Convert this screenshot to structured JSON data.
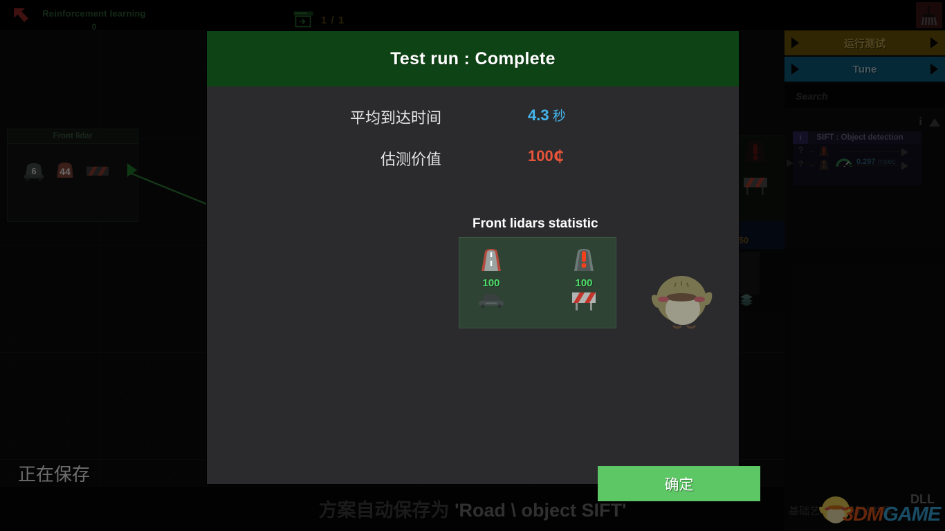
{
  "topbar": {
    "rl_title": "Reinforcement learning",
    "rl_value": "0",
    "run_count": "1 / 1",
    "back_arrow_icon": "back-arrow-icon",
    "run_icon": "run-window-icon",
    "trash_icon": "broom-icon"
  },
  "front_lidar": {
    "title": "Front lidar",
    "items": [
      {
        "icon": "car-icon",
        "value": "6"
      },
      {
        "icon": "barrier-icon",
        "value": "44"
      },
      {
        "icon": "stripes-icon",
        "value": ""
      }
    ],
    "play_icon": "play-arrow-icon"
  },
  "ghost": {
    "value_50": "50",
    "layers_icon": "layers-icon"
  },
  "sidebar": {
    "run_test_label": "运行测试",
    "tune_label": "Tune",
    "search_placeholder": "Search",
    "info_icon": "info-icon",
    "scroll_up_icon": "scroll-up-icon",
    "card": {
      "badge": "i",
      "title": "SIFT : Object detection",
      "rows": [
        {
          "question": "?",
          "arrow": "→",
          "icon": "road-alert-icon"
        },
        {
          "question": "?",
          "arrow": "→",
          "icon": "road-clear-icon"
        }
      ],
      "gauge_icon": "gauge-icon",
      "timing_value": "0.297",
      "timing_unit": "msec"
    }
  },
  "status": {
    "saving": "正在保存",
    "autosave_prefix": "方案自动保存为 ",
    "autosave_path": "'Road \\ object SIFT'"
  },
  "watermark": {
    "cn_text": "基础艺术效果设计共享",
    "logo_3d": "3DM",
    "logo_game": "GAME",
    "dll": "DLL",
    "bird_icon": "bird-mascot-icon"
  },
  "modal": {
    "title": "Test run : Complete",
    "stats": [
      {
        "label": "平均到达时间",
        "value": "4.3",
        "unit": " 秒",
        "color": "#45b6ef"
      },
      {
        "label": "估测价值",
        "value": "100",
        "unit": "₵",
        "color": "#e8543a"
      }
    ],
    "lidar_section_title": "Front lidars statistic",
    "lidar_columns": [
      {
        "top_icon": "road-clear-icon",
        "count": "100",
        "bottom_icon": "car-icon"
      },
      {
        "top_icon": "road-alert-icon",
        "count": "100",
        "bottom_icon": "barrier-icon"
      }
    ],
    "mascot_icon": "bird-mascot-icon",
    "ok_label": "确定"
  },
  "colors": {
    "header_green": "#0e4415",
    "body_dark": "#2b2b2d",
    "ok_green": "#5cc764",
    "count_green": "#4ddd69",
    "time_blue": "#45b6ef",
    "cost_red": "#e8543a",
    "tune_blue": "#0f5b7d",
    "run_gold": "#6b5409"
  }
}
